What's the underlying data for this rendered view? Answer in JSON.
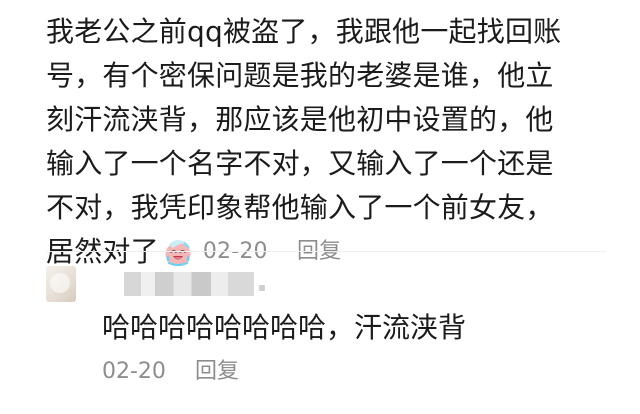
{
  "comment": {
    "lines": [
      "我老公之前qq被盗了，我跟他一起找回账",
      "号，有个密保问题是我的老婆是谁，他立",
      "刻汗流浃背，那应该是他初中设置的，他",
      "输入了一个名字不对，又输入了一个还是",
      "不对，我凭印象帮他输入了一个前女友，",
      "居然对了"
    ],
    "emoji_icon": "sweating-laughing-emoji-icon",
    "time": "02-20",
    "reply_label": "回复"
  },
  "reply": {
    "avatar_icon": "avatar",
    "text": "哈哈哈哈哈哈哈哈，汗流浃背",
    "time": "02-20",
    "reply_label": "回复"
  },
  "colors": {
    "text": "#1b1b1b",
    "meta": "#8d8d8d",
    "background": "#ffffff"
  }
}
